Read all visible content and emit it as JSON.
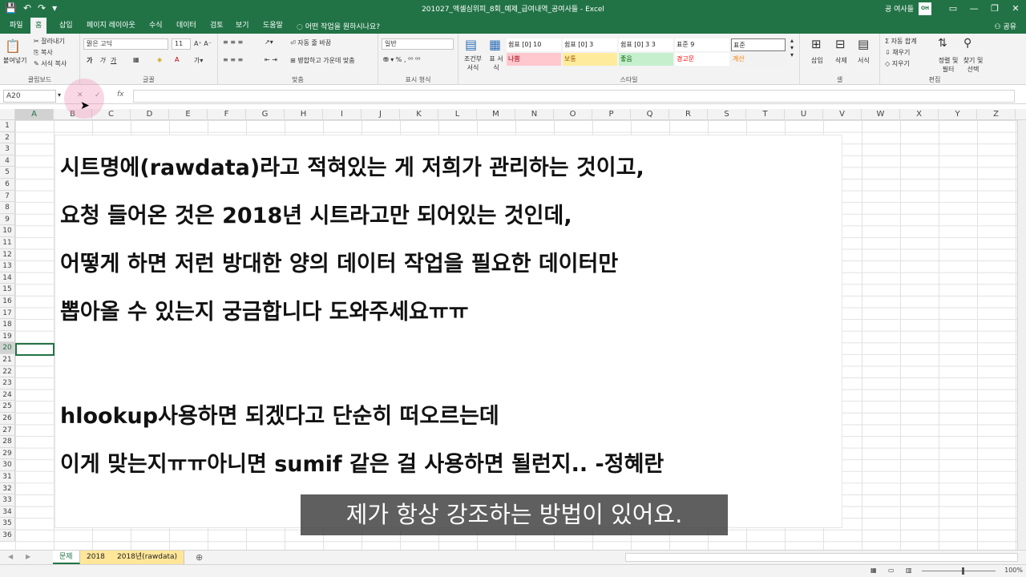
{
  "titlebar": {
    "document_title": "201027_엑셀심위피_8회_예제_급여내역_공여사들  -  Excel",
    "user_name": "공 여사들",
    "avatar_text": "OH",
    "qat_icons": [
      "save-icon",
      "undo-icon",
      "redo-icon",
      "customize-icon"
    ]
  },
  "tabs": [
    "파일",
    "홈",
    "삽입",
    "페이지 레이아웃",
    "수식",
    "데이터",
    "검토",
    "보기",
    "도움말"
  ],
  "tell_me": "어떤 작업을 원하시나요?",
  "share": "공유",
  "ribbon": {
    "clipboard": {
      "cut": "잘라내기",
      "copy": "복사",
      "format_painter": "서식 복사",
      "paste": "붙여넣기",
      "label": "클립보드"
    },
    "font": {
      "name": "맑은 고딕",
      "size": "11",
      "bold": "가",
      "italic": "가",
      "underline": "가",
      "label": "글꼴"
    },
    "alignment": {
      "wrap": "자동 줄 바꿈",
      "merge": "병합하고 가운데 맞춤",
      "label": "맞춤"
    },
    "number": {
      "format": "일반",
      "label": "표시 형식"
    },
    "styles": {
      "conditional": "조건부 서식",
      "table": "표 서식",
      "cells": [
        {
          "label": "쉼표 [0] 10",
          "color": "#ffffff",
          "text": "#222222"
        },
        {
          "label": "쉼표 [0] 3",
          "color": "#ffffff",
          "text": "#222222"
        },
        {
          "label": "쉼표 [0] 3 3",
          "color": "#ffffff",
          "text": "#222222"
        },
        {
          "label": "표준 9",
          "color": "#ffffff",
          "text": "#222222"
        },
        {
          "label": "표준",
          "color": "#ffffff",
          "text": "#222222"
        },
        {
          "label": "나쁨",
          "color": "#ffc7ce",
          "text": "#9c0006"
        },
        {
          "label": "보통",
          "color": "#ffeb9c",
          "text": "#9c5700"
        },
        {
          "label": "좋음",
          "color": "#c6efce",
          "text": "#006100"
        },
        {
          "label": "경고문",
          "color": "#ffffff",
          "text": "#ff0000"
        },
        {
          "label": "계산",
          "color": "#f2f2f2",
          "text": "#fa7d00"
        }
      ],
      "label": "스타일"
    },
    "cells_group": {
      "insert": "삽입",
      "delete": "삭제",
      "format": "서식",
      "label": "셀"
    },
    "editing": {
      "autosum": "자동 합계",
      "fill": "채우기",
      "clear": "지우기",
      "sort": "정렬 및 필터",
      "find": "찾기 및 선택",
      "label": "편집"
    }
  },
  "formula_bar": {
    "name_box": "A20",
    "fx": "fx",
    "value": ""
  },
  "columns": [
    "A",
    "B",
    "C",
    "D",
    "E",
    "F",
    "G",
    "H",
    "I",
    "J",
    "K",
    "L",
    "M",
    "N",
    "O",
    "P",
    "Q",
    "R",
    "S",
    "T",
    "U",
    "V",
    "W",
    "X",
    "Y",
    "Z"
  ],
  "rows": [
    "1",
    "2",
    "3",
    "4",
    "5",
    "6",
    "7",
    "8",
    "9",
    "10",
    "11",
    "12",
    "13",
    "14",
    "15",
    "16",
    "17",
    "18",
    "19",
    "20",
    "21",
    "22",
    "23",
    "24",
    "25",
    "26",
    "27",
    "28",
    "29",
    "30",
    "31",
    "32",
    "33",
    "34",
    "35",
    "36"
  ],
  "selected_cell": {
    "column": "A",
    "row": "20"
  },
  "textbox": {
    "lines": [
      "시트명에(rawdata)라고 적혀있는 게 저희가 관리하는 것이고,",
      "요청 들어온 것은 2018년 시트라고만 되어있는 것인데,",
      "어떻게 하면 저런 방대한 양의 데이터 작업을 필요한 데이터만",
      "뽑아올 수 있는지 궁금합니다 도와주세요ㅠㅠ",
      "hlookup사용하면 되겠다고 단순히 떠오르는데",
      "이게 맞는지ㅠㅠ아니면 sumif 같은 걸 사용하면 될런지.. -정혜란"
    ]
  },
  "subtitle": "제가 항상 강조하는 방법이 있어요.",
  "sheet_tabs": [
    {
      "label": "문제",
      "active": true
    },
    {
      "label": "2018",
      "active": false
    },
    {
      "label": "2018년(rawdata)",
      "active": false
    }
  ],
  "status": {
    "zoom": "100%"
  },
  "colors": {
    "excel_green": "#217346"
  }
}
